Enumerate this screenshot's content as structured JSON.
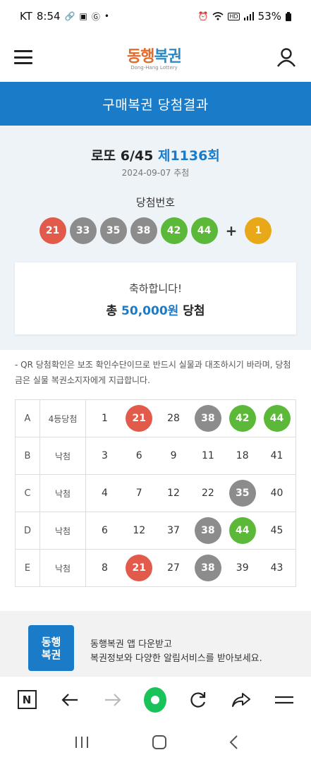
{
  "status_bar": {
    "carrier": "KT",
    "time": "8:54",
    "battery": "53%"
  },
  "header": {
    "logo_text_1": "동행",
    "logo_text_2": "복권",
    "logo_sub": "Dong-Hang Lottery"
  },
  "page_title": "구매복권 당첨결과",
  "draw": {
    "game": "로또 6/45",
    "round": "제1136회",
    "date": "2024-09-07 추첨",
    "win_label": "당첨번호",
    "numbers": [
      {
        "n": "21",
        "color": "#e25a4a"
      },
      {
        "n": "33",
        "color": "#8c8c8c"
      },
      {
        "n": "35",
        "color": "#8c8c8c"
      },
      {
        "n": "38",
        "color": "#8c8c8c"
      },
      {
        "n": "42",
        "color": "#5cb838"
      },
      {
        "n": "44",
        "color": "#5cb838"
      }
    ],
    "plus": "+",
    "bonus": {
      "n": "1",
      "color": "#e8a818"
    }
  },
  "result": {
    "congrats": "축하합니다!",
    "prize_prefix": "총",
    "prize_amount": "50,000원",
    "prize_suffix": "당첨"
  },
  "notice": "- QR 당첨확인은 보조 확인수단이므로 반드시 실물과 대조하시기 바라며, 당첨금은 실물 복권소지자에게 지급합니다.",
  "tickets": [
    {
      "row": "A",
      "rank": "4등당첨",
      "nums": [
        {
          "n": "1",
          "hit": ""
        },
        {
          "n": "21",
          "hit": "#e25a4a"
        },
        {
          "n": "28",
          "hit": ""
        },
        {
          "n": "38",
          "hit": "#8c8c8c"
        },
        {
          "n": "42",
          "hit": "#5cb838"
        },
        {
          "n": "44",
          "hit": "#5cb838"
        }
      ]
    },
    {
      "row": "B",
      "rank": "낙첨",
      "nums": [
        {
          "n": "3",
          "hit": ""
        },
        {
          "n": "6",
          "hit": ""
        },
        {
          "n": "9",
          "hit": ""
        },
        {
          "n": "11",
          "hit": ""
        },
        {
          "n": "18",
          "hit": ""
        },
        {
          "n": "41",
          "hit": ""
        }
      ]
    },
    {
      "row": "C",
      "rank": "낙첨",
      "nums": [
        {
          "n": "4",
          "hit": ""
        },
        {
          "n": "7",
          "hit": ""
        },
        {
          "n": "12",
          "hit": ""
        },
        {
          "n": "22",
          "hit": ""
        },
        {
          "n": "35",
          "hit": "#8c8c8c"
        },
        {
          "n": "40",
          "hit": ""
        }
      ]
    },
    {
      "row": "D",
      "rank": "낙첨",
      "nums": [
        {
          "n": "6",
          "hit": ""
        },
        {
          "n": "12",
          "hit": ""
        },
        {
          "n": "37",
          "hit": ""
        },
        {
          "n": "38",
          "hit": "#8c8c8c"
        },
        {
          "n": "44",
          "hit": "#5cb838"
        },
        {
          "n": "45",
          "hit": ""
        }
      ]
    },
    {
      "row": "E",
      "rank": "낙첨",
      "nums": [
        {
          "n": "8",
          "hit": ""
        },
        {
          "n": "21",
          "hit": "#e25a4a"
        },
        {
          "n": "27",
          "hit": ""
        },
        {
          "n": "38",
          "hit": "#8c8c8c"
        },
        {
          "n": "39",
          "hit": ""
        },
        {
          "n": "43",
          "hit": ""
        }
      ]
    }
  ],
  "promo": {
    "logo_line1": "동행",
    "logo_line2": "복권",
    "line1": "동행복권 앱 다운받고",
    "line2": "복권정보와 다양한 알림서비스를 받아보세요."
  },
  "browser_bar": {
    "n_label": "N"
  },
  "icons": [
    "link-icon",
    "image-icon",
    "g-icon",
    "alarm-icon",
    "wifi-icon",
    "hd-icon",
    "signal-icon",
    "battery-icon",
    "menu-icon",
    "user-icon",
    "n-icon",
    "back-icon",
    "forward-icon",
    "home-icon",
    "reload-icon",
    "share-icon",
    "browser-menu-icon",
    "recent-apps-icon",
    "system-home-icon",
    "system-back-icon"
  ]
}
